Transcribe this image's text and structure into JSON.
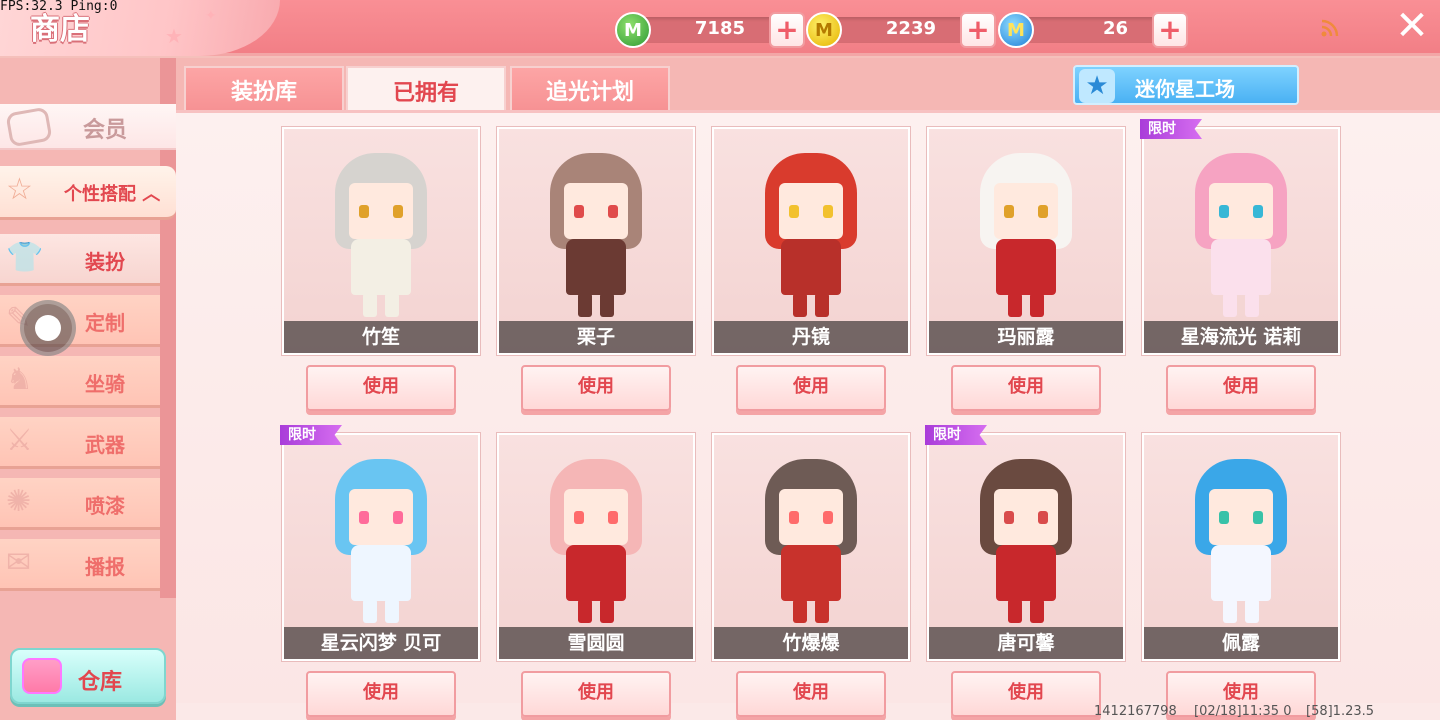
{
  "debug": {
    "fps_text": "FPS:32.3  Ping:0"
  },
  "header": {
    "title": "商店",
    "close_icon": "close-icon",
    "rss_icon": "rss-icon"
  },
  "currencies": [
    {
      "name": "green-gem",
      "amount": "7185",
      "color": "#2f9a35"
    },
    {
      "name": "gold-coin",
      "amount": "2239",
      "color": "#e5b300"
    },
    {
      "name": "blue-coin",
      "amount": "26",
      "color": "#1f7fd6"
    }
  ],
  "sidebar": {
    "member": "会员",
    "group": "个性搭配",
    "items": [
      {
        "label": "装扮",
        "icon": "shirt-icon",
        "active": true
      },
      {
        "label": "定制",
        "icon": "ruler-icon"
      },
      {
        "label": "坐骑",
        "icon": "mount-icon"
      },
      {
        "label": "武器",
        "icon": "gun-icon"
      },
      {
        "label": "喷漆",
        "icon": "spray-icon"
      },
      {
        "label": "播报",
        "icon": "broadcast-icon"
      }
    ],
    "warehouse": "仓库"
  },
  "tabs": [
    {
      "label": "装扮库",
      "active": false
    },
    {
      "label": "已拥有",
      "active": true
    },
    {
      "label": "追光计划",
      "active": false
    }
  ],
  "workshop_button": "迷你星工场",
  "limited_label": "限时",
  "use_label": "使用",
  "skins": [
    {
      "name": "竹笙",
      "limited": false
    },
    {
      "name": "栗子",
      "limited": false
    },
    {
      "name": "丹镜",
      "limited": false
    },
    {
      "name": "玛丽露",
      "limited": false
    },
    {
      "name": "星海流光 诺莉",
      "limited": true
    },
    {
      "name": "星云闪梦 贝可",
      "limited": true
    },
    {
      "name": "雪圆圆",
      "limited": false
    },
    {
      "name": "竹爆爆",
      "limited": false
    },
    {
      "name": "唐可馨",
      "limited": true
    },
    {
      "name": "佩露",
      "limited": false
    }
  ],
  "footer": {
    "uid": "1412167798",
    "time": "[02/18]11:35 0",
    "version": "[58]1.23.5"
  },
  "colors": {
    "accent": "#e2474f",
    "topbar": "#f27f86",
    "limited": "#a93cd9"
  }
}
